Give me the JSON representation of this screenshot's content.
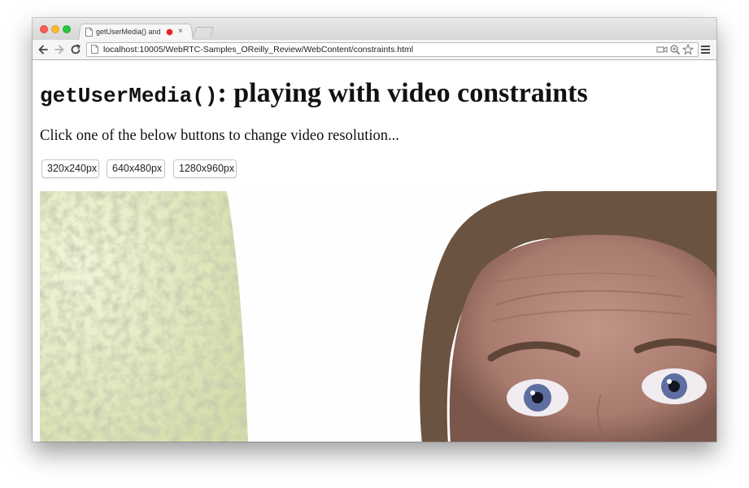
{
  "browser": {
    "tab": {
      "title": "getUserMedia() and con",
      "favicon": "page-icon",
      "recording_indicator": "recording-dot-icon",
      "close_glyph": "×"
    },
    "new_tab": "new-tab-button",
    "toolbar": {
      "back": "back-arrow-icon",
      "forward": "forward-arrow-icon",
      "reload": "reload-icon",
      "url": "localhost:10005/WebRTC-Samples_OReilly_Review/WebContent/constraints.html",
      "right_icons": [
        "video-camera-icon",
        "zoom-icon",
        "star-icon"
      ],
      "menu": "hamburger-menu-icon"
    }
  },
  "page": {
    "heading_code": "getUserMedia()",
    "heading_text": ": playing with video constraints",
    "instructions": "Click one of the below buttons to change video resolution...",
    "buttons": [
      {
        "label": "320x240px"
      },
      {
        "label": "640x480px"
      },
      {
        "label": "1280x960px"
      }
    ]
  },
  "colors": {
    "record_red": "#e0201b",
    "traffic_close": "#fc5b57",
    "traffic_min": "#fdbc2e",
    "traffic_max": "#29c840",
    "wall_texture": "#e6eab8",
    "skin": "#b88678",
    "hair": "#6a5340"
  }
}
